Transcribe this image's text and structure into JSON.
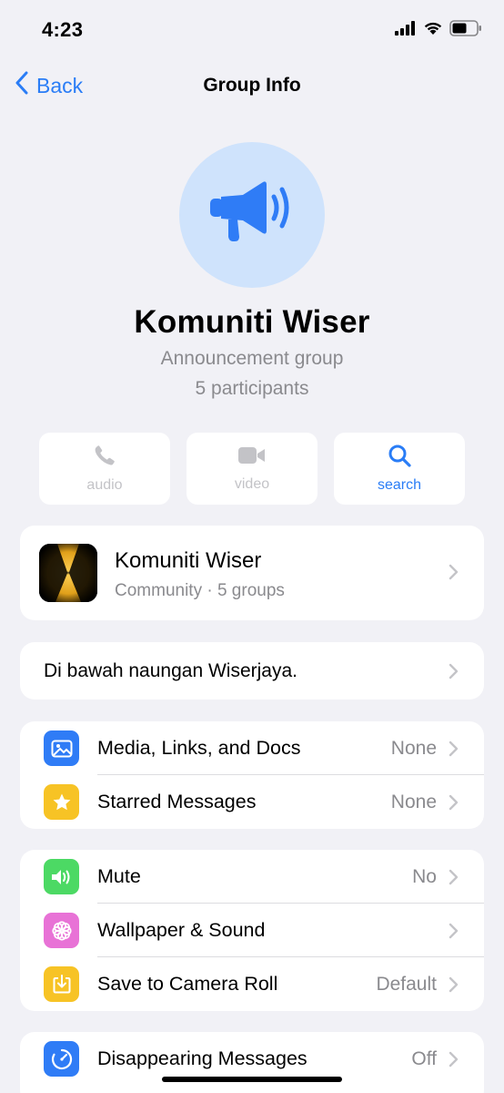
{
  "status_bar": {
    "time": "4:23"
  },
  "nav": {
    "back_label": "Back",
    "title": "Group Info"
  },
  "group": {
    "name": "Komuniti Wiser",
    "type": "Announcement group",
    "participants": "5 participants"
  },
  "actions": [
    {
      "label": "audio",
      "icon": "phone-icon",
      "enabled": false
    },
    {
      "label": "video",
      "icon": "video-camera-icon",
      "enabled": false
    },
    {
      "label": "search",
      "icon": "search-icon",
      "enabled": true
    }
  ],
  "community": {
    "name": "Komuniti Wiser",
    "subtitle": "Community · 5 groups"
  },
  "description": "Di bawah naungan Wiserjaya.",
  "media_section": [
    {
      "label": "Media, Links, and Docs",
      "value": "None",
      "icon": "photo-icon",
      "color": "#2f7cf6"
    },
    {
      "label": "Starred Messages",
      "value": "None",
      "icon": "star-icon",
      "color": "#f7c325"
    }
  ],
  "settings_section": [
    {
      "label": "Mute",
      "value": "No",
      "icon": "speaker-icon",
      "color": "#4cd964"
    },
    {
      "label": "Wallpaper & Sound",
      "value": "",
      "icon": "flower-icon",
      "color": "#e872d6"
    },
    {
      "label": "Save to Camera Roll",
      "value": "Default",
      "icon": "download-icon",
      "color": "#f7c325"
    }
  ],
  "disappearing_section": [
    {
      "label": "Disappearing Messages",
      "value": "Off",
      "icon": "timer-icon",
      "color": "#2f7cf6"
    }
  ],
  "colors": {
    "accent": "#2a7df6",
    "background": "#f1f1f6",
    "secondary_text": "#8a8a8e"
  }
}
